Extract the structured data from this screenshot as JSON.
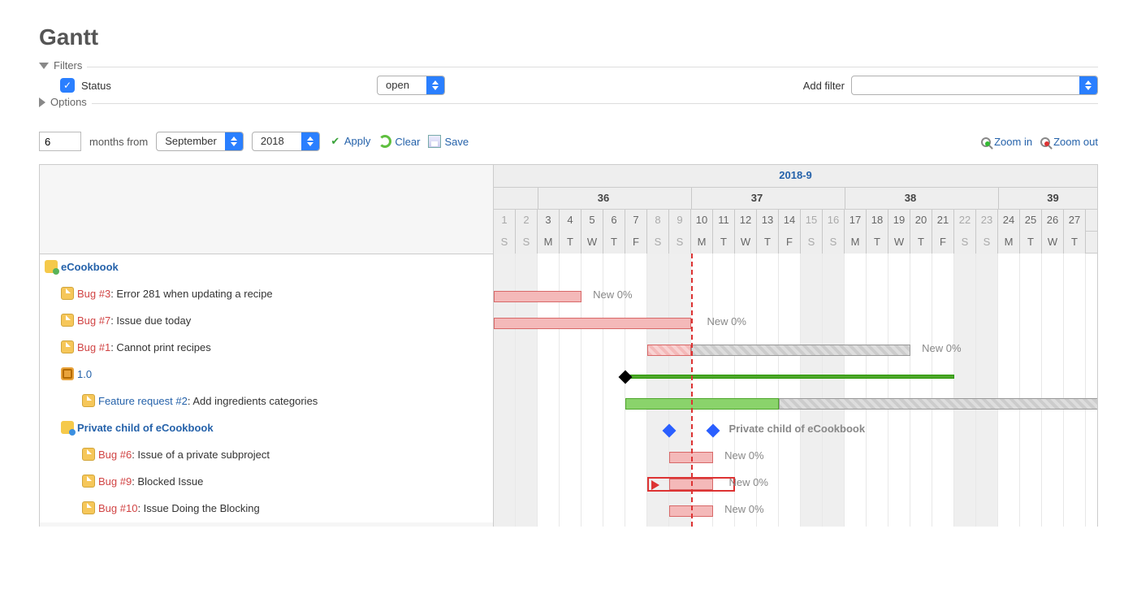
{
  "title": "Gantt",
  "filters": {
    "legend": "Filters",
    "status_label": "Status",
    "status_checked": true,
    "status_value": "open",
    "add_filter_label": "Add filter",
    "add_filter_value": ""
  },
  "options": {
    "legend": "Options"
  },
  "controls": {
    "months_value": "6",
    "months_label": "months from",
    "month_select": "September",
    "year_select": "2018",
    "apply": "Apply",
    "clear": "Clear",
    "save": "Save",
    "zoom_in": "Zoom in",
    "zoom_out": "Zoom out"
  },
  "calendar": {
    "month_header": "2018-9",
    "weeks": [
      {
        "num": "36",
        "col": 5
      },
      {
        "num": "37",
        "col": 12
      },
      {
        "num": "38",
        "col": 19
      },
      {
        "num": "39",
        "col": 25.5
      }
    ],
    "days": [
      {
        "n": "1",
        "d": "S",
        "w": true
      },
      {
        "n": "2",
        "d": "S",
        "w": true
      },
      {
        "n": "3",
        "d": "M"
      },
      {
        "n": "4",
        "d": "T"
      },
      {
        "n": "5",
        "d": "W"
      },
      {
        "n": "6",
        "d": "T"
      },
      {
        "n": "7",
        "d": "F"
      },
      {
        "n": "8",
        "d": "S",
        "w": true
      },
      {
        "n": "9",
        "d": "S",
        "w": true
      },
      {
        "n": "10",
        "d": "M"
      },
      {
        "n": "11",
        "d": "T"
      },
      {
        "n": "12",
        "d": "W"
      },
      {
        "n": "13",
        "d": "T"
      },
      {
        "n": "14",
        "d": "F"
      },
      {
        "n": "15",
        "d": "S",
        "w": true
      },
      {
        "n": "16",
        "d": "S",
        "w": true
      },
      {
        "n": "17",
        "d": "M"
      },
      {
        "n": "18",
        "d": "T"
      },
      {
        "n": "19",
        "d": "W"
      },
      {
        "n": "20",
        "d": "T"
      },
      {
        "n": "21",
        "d": "F"
      },
      {
        "n": "22",
        "d": "S",
        "w": true
      },
      {
        "n": "23",
        "d": "S",
        "w": true
      },
      {
        "n": "24",
        "d": "M"
      },
      {
        "n": "25",
        "d": "T"
      },
      {
        "n": "26",
        "d": "W"
      },
      {
        "n": "27",
        "d": "T"
      }
    ],
    "today_col": 9
  },
  "rows": [
    {
      "type": "project",
      "indent": 0,
      "text": "eCookbook"
    },
    {
      "type": "issue",
      "indent": 1,
      "id": "Bug #3",
      "title": "Error 281 when updating a recipe",
      "status": "New 0%",
      "bar": {
        "start": 0,
        "end": 4,
        "cls": "red"
      },
      "label_at": 4.3
    },
    {
      "type": "issue",
      "indent": 1,
      "id": "Bug #7",
      "title": "Issue due today",
      "status": "New 0%",
      "bar": {
        "start": 0,
        "end": 9,
        "cls": "red"
      },
      "label_at": 9.5
    },
    {
      "type": "issue",
      "indent": 1,
      "id": "Bug #1",
      "title": "Cannot print recipes",
      "status": "New 0%",
      "bars": [
        {
          "start": 7,
          "end": 9,
          "cls": "red hatch"
        },
        {
          "start": 9,
          "end": 19,
          "cls": "gray hatch"
        }
      ],
      "label_at": 19.3
    },
    {
      "type": "version",
      "indent": 1,
      "text": "1.0",
      "line": {
        "start": 6,
        "end": 21
      },
      "diam": {
        "at": 6,
        "cls": "black"
      }
    },
    {
      "type": "issue",
      "indent": 2,
      "id": "Feature request #2",
      "title": "Add ingredients categories",
      "status": "",
      "bars": [
        {
          "start": 6,
          "end": 13,
          "cls": "green"
        },
        {
          "start": 13,
          "end": 28,
          "cls": "gray hatch"
        }
      ]
    },
    {
      "type": "project",
      "indent": 1,
      "text": "Private child of eCookbook",
      "sub": true,
      "diam": [
        {
          "at": 8,
          "cls": "blue"
        },
        {
          "at": 10,
          "cls": "blue"
        }
      ],
      "label": "Private child of eCookbook",
      "label_at": 10.5,
      "bold": true
    },
    {
      "type": "issue",
      "indent": 2,
      "id": "Bug #6",
      "title": "Issue of a private subproject",
      "status": "New 0%",
      "bar": {
        "start": 8,
        "end": 10,
        "cls": "red"
      },
      "label_at": 10.3
    },
    {
      "type": "issue",
      "indent": 2,
      "id": "Bug #9",
      "title": "Blocked Issue",
      "status": "New 0%",
      "bar": {
        "start": 8,
        "end": 10,
        "cls": "red"
      },
      "label_at": 10.5,
      "redbox": {
        "start": 7,
        "end": 11
      },
      "arrow_at": 7.2
    },
    {
      "type": "issue",
      "indent": 2,
      "id": "Bug #10",
      "title": "Issue Doing the Blocking",
      "status": "New 0%",
      "bar": {
        "start": 8,
        "end": 10,
        "cls": "red"
      },
      "label_at": 10.3
    }
  ]
}
